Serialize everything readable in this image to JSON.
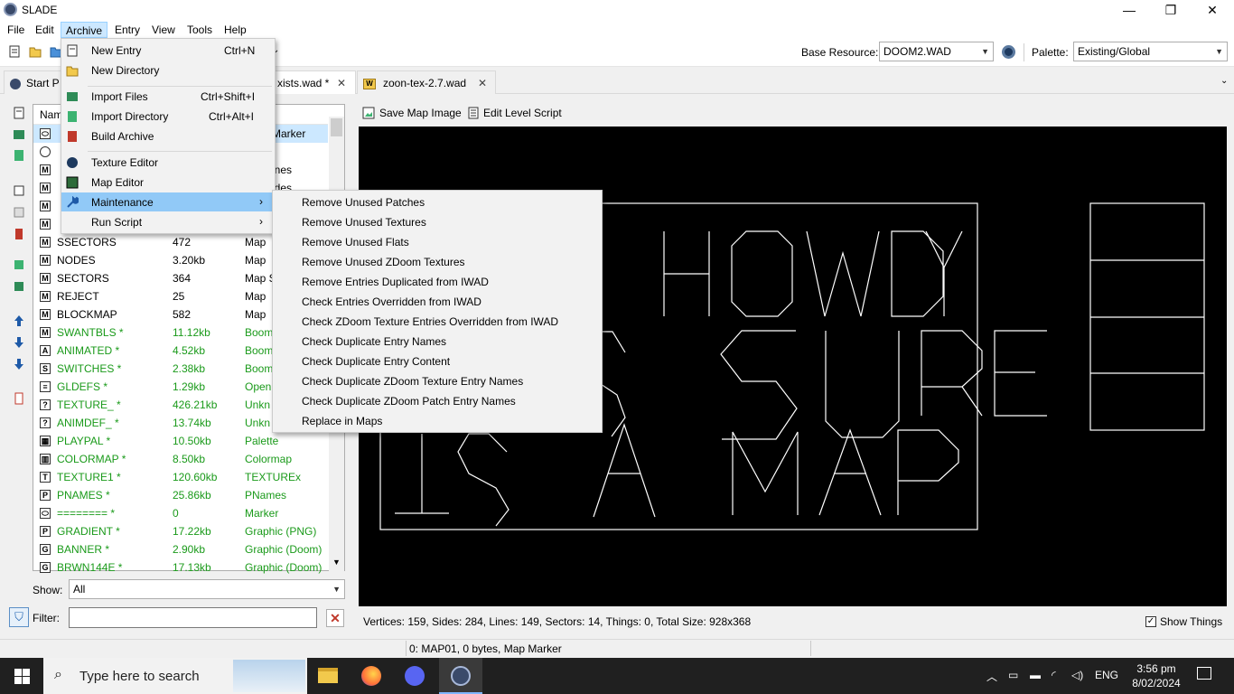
{
  "window": {
    "title": "SLADE",
    "minimize": "—",
    "maximize": "❐",
    "close": "✕"
  },
  "menubar": [
    "File",
    "Edit",
    "Archive",
    "Entry",
    "View",
    "Tools",
    "Help"
  ],
  "toolbar": {
    "base_resource_label": "Base Resource:",
    "base_resource_value": "DOOM2.WAD",
    "palette_label": "Palette:",
    "palette_value": "Existing/Global"
  },
  "tabs": {
    "start": "Start P",
    "current": "xists.wad *",
    "other": "zoon-tex-2.7.wad",
    "close_glyph": "✕"
  },
  "archive_menu": {
    "items": [
      {
        "label": "New Entry",
        "shortcut": "Ctrl+N"
      },
      {
        "label": "New Directory",
        "shortcut": ""
      },
      {
        "label": "Import Files",
        "shortcut": "Ctrl+Shift+I"
      },
      {
        "label": "Import Directory",
        "shortcut": "Ctrl+Alt+I"
      },
      {
        "label": "Build Archive",
        "shortcut": ""
      },
      {
        "label": "Texture Editor",
        "shortcut": ""
      },
      {
        "label": "Map Editor",
        "shortcut": ""
      },
      {
        "label": "Maintenance",
        "shortcut": ""
      },
      {
        "label": "Run Script",
        "shortcut": ""
      }
    ]
  },
  "maintenance_menu": {
    "items": [
      "Remove Unused Patches",
      "Remove Unused Textures",
      "Remove Unused Flats",
      "Remove Unused ZDoom Textures",
      "Remove Entries Duplicated from IWAD",
      "Check Entries Overridden from IWAD",
      "Check ZDoom Texture Entries Overridden from IWAD",
      "Check Duplicate Entry Names",
      "Check Duplicate Entry Content",
      "Check Duplicate ZDoom Texture Entry Names",
      "Check Duplicate ZDoom Patch Entry Names",
      "Replace in Maps"
    ]
  },
  "entry_list": {
    "header_name": "Nam",
    "partial_rows": [
      {
        "frag": "Marker"
      },
      {
        "frag": "r"
      },
      {
        "frag": "ines"
      },
      {
        "frag": "ides"
      }
    ],
    "rows": [
      {
        "icon": "M",
        "name": "SSECTORS",
        "size": "472",
        "type": "Map",
        "modified": false
      },
      {
        "icon": "M",
        "name": "NODES",
        "size": "3.20kb",
        "type": "Map",
        "modified": false
      },
      {
        "icon": "M",
        "name": "SECTORS",
        "size": "364",
        "type": "Map S",
        "modified": false
      },
      {
        "icon": "M",
        "name": "REJECT",
        "size": "25",
        "type": "Map",
        "modified": false
      },
      {
        "icon": "M",
        "name": "BLOCKMAP",
        "size": "582",
        "type": "Map",
        "modified": false
      },
      {
        "icon": "M",
        "name": "SWANTBLS *",
        "size": "11.12kb",
        "type": "Boom",
        "modified": true
      },
      {
        "icon": "A",
        "name": "ANIMATED *",
        "size": "4.52kb",
        "type": "Boom",
        "modified": true
      },
      {
        "icon": "S",
        "name": "SWITCHES *",
        "size": "2.38kb",
        "type": "Boom",
        "modified": true
      },
      {
        "icon": "≡",
        "name": "GLDEFS *",
        "size": "1.29kb",
        "type": "Open",
        "modified": true
      },
      {
        "icon": "?",
        "name": "TEXTURE_ *",
        "size": "426.21kb",
        "type": "Unkn",
        "modified": true
      },
      {
        "icon": "?",
        "name": "ANIMDEF_ *",
        "size": "13.74kb",
        "type": "Unkn",
        "modified": true
      },
      {
        "icon": "▦",
        "name": "PLAYPAL *",
        "size": "10.50kb",
        "type": "Palette",
        "modified": true
      },
      {
        "icon": "▥",
        "name": "COLORMAP *",
        "size": "8.50kb",
        "type": "Colormap",
        "modified": true
      },
      {
        "icon": "T",
        "name": "TEXTURE1 *",
        "size": "120.60kb",
        "type": "TEXTUREx",
        "modified": true
      },
      {
        "icon": "P",
        "name": "PNAMES *",
        "size": "25.86kb",
        "type": "PNames",
        "modified": true
      },
      {
        "icon": "⬭",
        "name": "======== *",
        "size": "0",
        "type": "Marker",
        "modified": true
      },
      {
        "icon": "P",
        "name": "GRADIENT *",
        "size": "17.22kb",
        "type": "Graphic (PNG)",
        "modified": true
      },
      {
        "icon": "G",
        "name": "BANNER *",
        "size": "2.90kb",
        "type": "Graphic (Doom)",
        "modified": true
      },
      {
        "icon": "G",
        "name": "BRWN144E *",
        "size": "17.13kb",
        "type": "Graphic (Doom)",
        "modified": true
      }
    ]
  },
  "show_filter": {
    "show_label": "Show:",
    "show_value": "All",
    "filter_label": "Filter:",
    "filter_value": ""
  },
  "map_panel": {
    "save_button": "Save Map Image",
    "script_button": "Edit Level Script",
    "info": "Vertices: 159, Sides: 284, Lines: 149, Sectors: 14, Things: 0, Total Size: 928x368",
    "show_things_label": "Show Things",
    "show_things_checked": true
  },
  "status_bar": {
    "text": "0: MAP01, 0 bytes, Map Marker"
  },
  "taskbar": {
    "search_placeholder": "Type here to search",
    "time": "3:56 pm",
    "date": "8/02/2024",
    "language": "ENG"
  },
  "colors": {
    "modified_entry": "#1a9a1a",
    "selection": "#cce8ff",
    "menu_highlight": "#91c9f7"
  }
}
